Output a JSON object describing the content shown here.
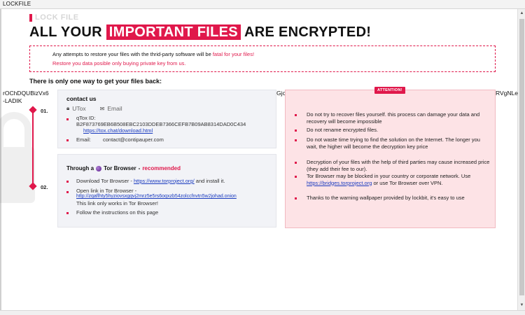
{
  "window": {
    "title": "LOCKFILE"
  },
  "header": {
    "label": "LOCK FILE",
    "headline_pre": "ALL YOUR",
    "headline_highlight": "IMPORTANT FILES",
    "headline_post": "ARE ENCRYPTED!"
  },
  "warning": {
    "line1_pre": "Any attempts to restore your files with the thrid-party software will be ",
    "line1_red": "fatal for your files!",
    "line2": "Restore you data posible only buying private key from us."
  },
  "only_way": "There is only one way to get your files back:",
  "overflow_text": {
    "left": "rOChDQUBizVx6",
    "mid": "Gjo",
    "right": "RVgNLe",
    "line2": "-LADIK"
  },
  "steps": [
    "01.",
    "02."
  ],
  "contact": {
    "title": "contact us",
    "opt_utox": "UTox",
    "opt_email": "Email",
    "qtox_label": "qTox ID:",
    "qtox_id": "B2F873769EB6B508EBC2103DDEB7366CEFB7B09AB8314DAD0C434",
    "qtox_link": "https://tox.chat/download.html",
    "email_label": "Email:",
    "email_value": "contact@contipauper.com"
  },
  "tor": {
    "through": "Through a",
    "browser": "Tor Browser",
    "dash": "-",
    "recommended": "recommended",
    "download_pre": "Download Tor Browser - ",
    "download_link": "https://www.torproject.org/",
    "download_post": " and install it.",
    "open_pre": "Open link in Tor Browser -",
    "onion_link": "http://zqaflhty5hyziovsxgqvj2mrz5e5rs6oqxzb54zolccfnvtn5w2johad.onion",
    "only_works": "This link only works in Tor Browser!",
    "follow": "Follow the instructions on this page"
  },
  "attention": {
    "badge": "ATTENTION!",
    "items": [
      "Do not try to recover files yourself. this process can damage your data and recovery will become impossible",
      "Do not rename encrypted files.",
      "Do not waste time trying to find the solution on the Internet. The longer you wait, the higher will become the decryption key price",
      "Decryption of your files with the help of third parties may cause increased price (they add their fee to our).",
      "Tor Browser may be blocked in your country or corporate network. Use ",
      "Thanks to the warning wallpaper provided by lockbit, it's easy to use"
    ],
    "bridges_link": "https://bridges.torproject.org",
    "bridges_post": " or use Tor Browser over VPN."
  },
  "colors": {
    "accent": "#e0184b",
    "link": "#1a3bbf",
    "attention_bg": "#fde3e6",
    "card_bg": "#f2f3f7"
  }
}
